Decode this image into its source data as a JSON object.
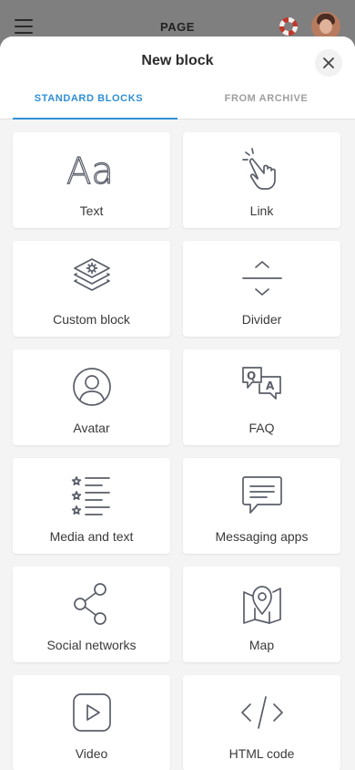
{
  "topbar": {
    "title": "PAGE"
  },
  "sheet": {
    "title": "New block",
    "tabs": [
      {
        "label": "STANDARD BLOCKS",
        "active": true
      },
      {
        "label": "FROM ARCHIVE",
        "active": false
      }
    ]
  },
  "blocks": [
    {
      "label": "Text",
      "icon": "text-icon"
    },
    {
      "label": "Link",
      "icon": "pointing-hand-icon"
    },
    {
      "label": "Custom block",
      "icon": "layers-gear-icon"
    },
    {
      "label": "Divider",
      "icon": "divider-icon"
    },
    {
      "label": "Avatar",
      "icon": "user-circle-icon"
    },
    {
      "label": "FAQ",
      "icon": "qa-bubbles-icon"
    },
    {
      "label": "Media and text",
      "icon": "star-list-icon"
    },
    {
      "label": "Messaging apps",
      "icon": "chat-bubble-icon"
    },
    {
      "label": "Social networks",
      "icon": "share-icon"
    },
    {
      "label": "Map",
      "icon": "map-pin-icon"
    },
    {
      "label": "Video",
      "icon": "play-icon"
    },
    {
      "label": "HTML code",
      "icon": "code-icon"
    }
  ],
  "text_icon_glyph": "Aa",
  "faq_icon_glyphs": {
    "q": "Q",
    "a": "A"
  },
  "colors": {
    "accent": "#2f8fd6",
    "overlay": "#7f7f7f",
    "sheet_bg": "#f4f4f4",
    "icon_stroke": "#5a5e69"
  }
}
